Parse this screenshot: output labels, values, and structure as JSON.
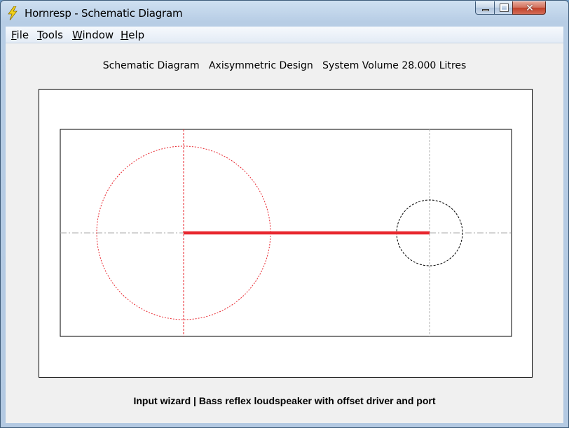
{
  "window": {
    "title": "Hornresp - Schematic Diagram",
    "controls": {
      "minimize": "",
      "maximize": "",
      "close": "✕"
    }
  },
  "menu": [
    {
      "accel": "F",
      "rest": "ile"
    },
    {
      "accel": "T",
      "rest": "ools"
    },
    {
      "accel": "W",
      "rest": "indow"
    },
    {
      "accel": "H",
      "rest": "elp"
    }
  ],
  "header": {
    "label": "Schematic Diagram   Axisymmetric Design   System Volume 28.000 Litres"
  },
  "footer": {
    "label": "Input wizard | Bass reflex loudspeaker with offset driver and port"
  },
  "colors": {
    "driver": "#e8262e",
    "port": "#000000",
    "centerline": "#a0a0a0",
    "window_bg": "#f0f0f0"
  }
}
